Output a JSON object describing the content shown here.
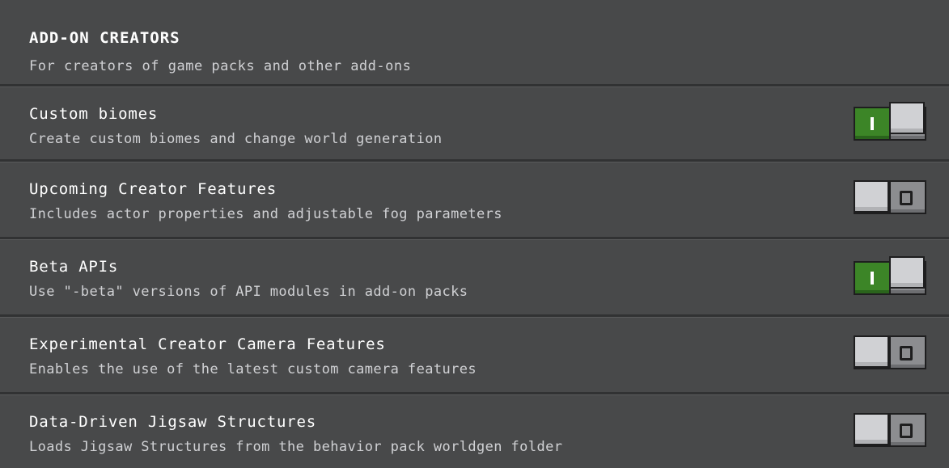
{
  "section": {
    "title": "ADD-ON CREATORS",
    "description": "For creators of game packs and other add-ons"
  },
  "toggle_glyphs": {
    "on": "I",
    "off": "O"
  },
  "colors": {
    "background": "#48494a",
    "toggle_on": "#3c8527",
    "toggle_off": "#8c8d90",
    "knob": "#d0d1d4"
  },
  "settings": [
    {
      "title": "Custom biomes",
      "description": "Create custom biomes and change world generation",
      "enabled": true
    },
    {
      "title": "Upcoming Creator Features",
      "description": "Includes actor properties and adjustable fog parameters",
      "enabled": false
    },
    {
      "title": "Beta APIs",
      "description": "Use \"-beta\" versions of API modules in add-on packs",
      "enabled": true
    },
    {
      "title": "Experimental Creator Camera Features",
      "description": "Enables the use of the latest custom camera features",
      "enabled": false
    },
    {
      "title": "Data-Driven Jigsaw Structures",
      "description": "Loads Jigsaw Structures from the behavior pack worldgen folder",
      "enabled": false
    }
  ]
}
